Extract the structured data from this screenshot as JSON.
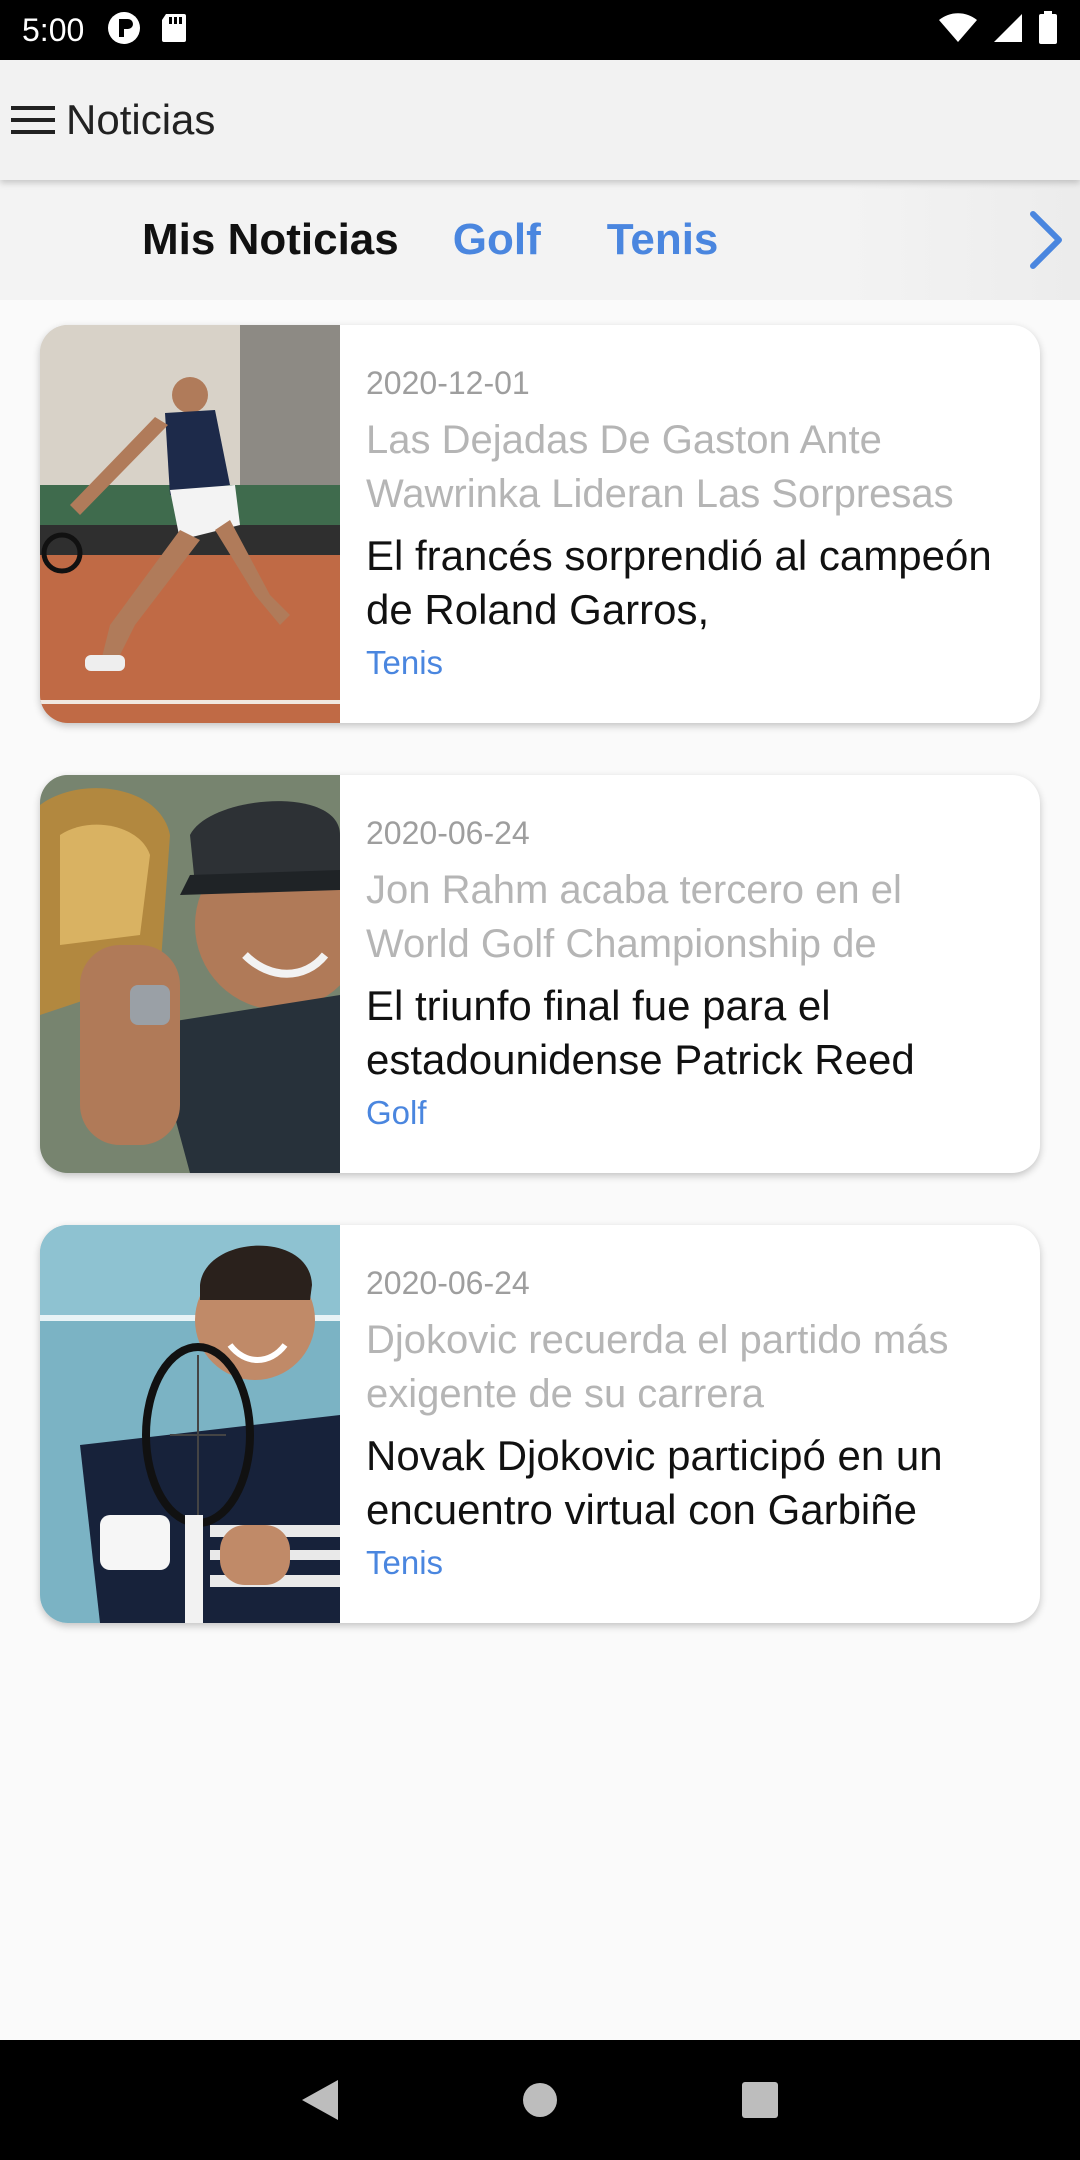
{
  "status_bar": {
    "time": "5:00",
    "icons_left": [
      "privacy-icon",
      "sd-card-icon"
    ],
    "icons_right": [
      "wifi-icon",
      "signal-icon",
      "battery-icon"
    ]
  },
  "app_bar": {
    "title": "Noticias",
    "menu_icon": "hamburger-menu-icon"
  },
  "tabs": {
    "items": [
      {
        "label": "Mis Noticias",
        "active": true
      },
      {
        "label": "Golf",
        "active": false
      },
      {
        "label": "Tenis",
        "active": false
      }
    ],
    "next_icon": "chevron-right-icon"
  },
  "colors": {
    "accent": "#4a86df",
    "date": "#9e9e9e",
    "title": "#b5b5b5",
    "summary": "#111111"
  },
  "news": [
    {
      "date": "2020-12-01",
      "title": "Las Dejadas De Gaston Ante Wawrinka Lideran Las Sorpresas",
      "summary": "El francés sorprendió al campeón de Roland Garros,",
      "category": "Tenis"
    },
    {
      "date": "2020-06-24",
      "title": "Jon Rahm acaba tercero en el World Golf Championship de",
      "summary": "El triunfo final fue para el estadounidense Patrick Reed",
      "category": "Golf"
    },
    {
      "date": "2020-06-24",
      "title": "Djokovic recuerda el partido más exigente de su carrera",
      "summary": "Novak Djokovic participó en un encuentro virtual con Garbiñe",
      "category": "Tenis"
    }
  ],
  "nav_bar": {
    "buttons": [
      "back-icon",
      "home-icon",
      "recents-icon"
    ]
  }
}
